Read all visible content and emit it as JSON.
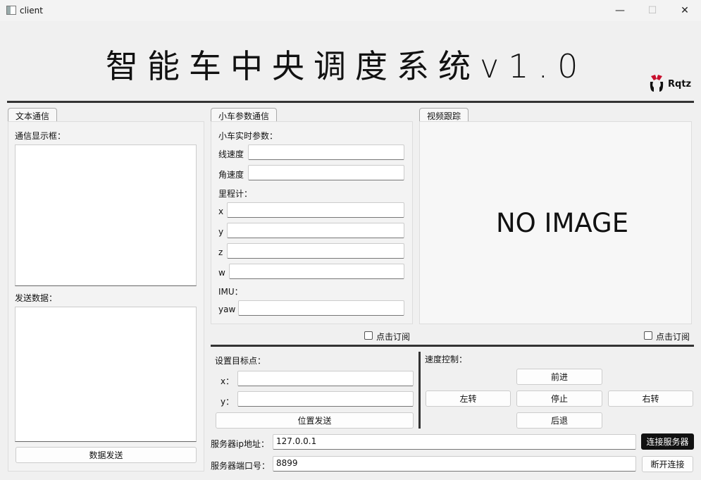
{
  "window": {
    "title": "client",
    "minimize": "—",
    "maximize": "☐",
    "close": "✕"
  },
  "header": {
    "title": "智能车中央调度系统v1.0",
    "logo_text": "Rqtz"
  },
  "text_comm": {
    "tab": "文本通信",
    "display_label": "通信显示框：",
    "send_label": "发送数据：",
    "send_button": "数据发送"
  },
  "car_params": {
    "tab": "小车参数通信",
    "realtime_label": "小车实时参数：",
    "linear_label": "线速度",
    "angular_label": "角速度",
    "odom_label": "里程计：",
    "x_label": "x",
    "y_label": "y",
    "z_label": "z",
    "w_label": "w",
    "imu_label": "IMU：",
    "yaw_label": "yaw",
    "subscribe_label": "点击订阅"
  },
  "video": {
    "tab": "视频跟踪",
    "no_image": "NO IMAGE",
    "subscribe_label": "点击订阅"
  },
  "target": {
    "label": "设置目标点：",
    "x_label": "x：",
    "y_label": "y：",
    "send_button": "位置发送"
  },
  "speed": {
    "label": "速度控制：",
    "forward": "前进",
    "left": "左转",
    "stop": "停止",
    "right": "右转",
    "back": "后退"
  },
  "server": {
    "ip_label": "服务器ip地址：",
    "ip_value": "127.0.0.1",
    "port_label": "服务器端口号：",
    "port_value": "8899",
    "connect_button": "连接服务器",
    "disconnect_button": "断开连接"
  }
}
